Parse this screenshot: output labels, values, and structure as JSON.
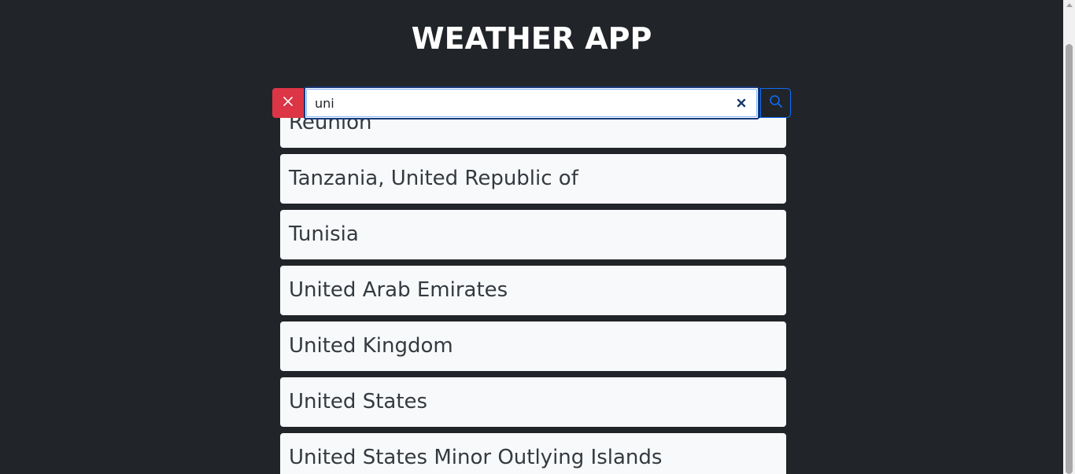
{
  "header": {
    "title": "WEATHER APP"
  },
  "search": {
    "value": "uni",
    "placeholder": "",
    "close_icon": "x-icon",
    "clear_icon": "x-icon",
    "search_icon": "search-icon"
  },
  "results": {
    "items": [
      {
        "label": "Réunion"
      },
      {
        "label": "Tanzania, United Republic of"
      },
      {
        "label": "Tunisia"
      },
      {
        "label": "United Arab Emirates"
      },
      {
        "label": "United Kingdom"
      },
      {
        "label": "United States"
      },
      {
        "label": "United States Minor Outlying Islands"
      }
    ]
  },
  "colors": {
    "background": "#212529",
    "close_button": "#dc3545",
    "search_button_border": "#0d6efd",
    "result_bg": "#f8f9fa",
    "result_text": "#343a40"
  }
}
